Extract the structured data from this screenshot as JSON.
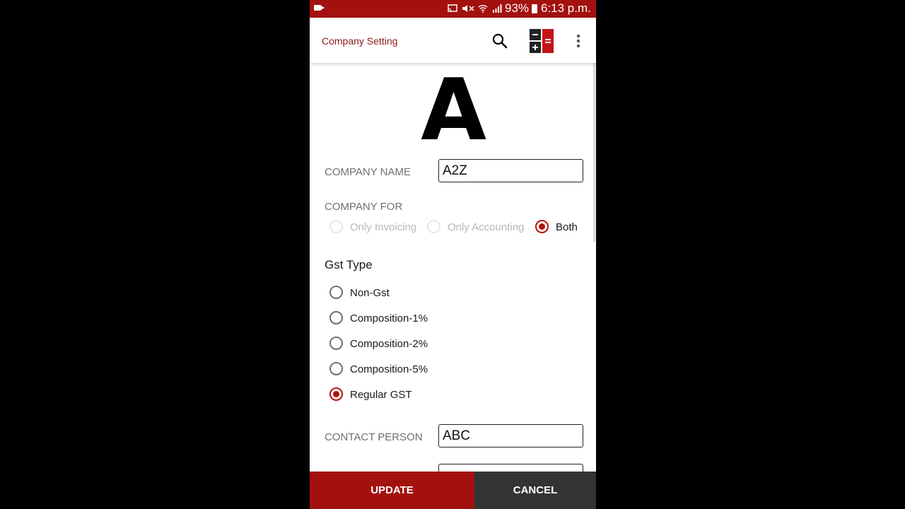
{
  "status_bar": {
    "battery": "93%",
    "time": "6:13 p.m.",
    "icons": [
      "video-icon",
      "cast-icon",
      "mute-icon",
      "wifi-icon",
      "signal-icon",
      "battery-icon"
    ]
  },
  "app_bar": {
    "title": "Company Setting",
    "actions": [
      "search-icon",
      "calculator-icon",
      "more-vert-icon"
    ]
  },
  "logo": {
    "letter": "A"
  },
  "company_name": {
    "label": "COMPANY NAME",
    "value": "A2Z"
  },
  "company_for": {
    "label": "COMPANY FOR",
    "options": [
      {
        "label": "Only Invoicing",
        "checked": false,
        "enabled": false
      },
      {
        "label": "Only Accounting",
        "checked": false,
        "enabled": false
      },
      {
        "label": "Both",
        "checked": true,
        "enabled": true
      }
    ]
  },
  "gst_type": {
    "title": "Gst Type",
    "options": [
      {
        "label": "Non-Gst",
        "checked": false
      },
      {
        "label": "Composition-1%",
        "checked": false
      },
      {
        "label": "Composition-2%",
        "checked": false
      },
      {
        "label": "Composition-5%",
        "checked": false
      },
      {
        "label": "Regular GST",
        "checked": true
      }
    ]
  },
  "contact_person": {
    "label": "CONTACT PERSON",
    "value": "ABC"
  },
  "actions": {
    "update": "UPDATE",
    "cancel": "CANCEL"
  },
  "colors": {
    "primary": "#a3110f",
    "secondary_button": "#333333",
    "accent_radio": "#b01510"
  }
}
